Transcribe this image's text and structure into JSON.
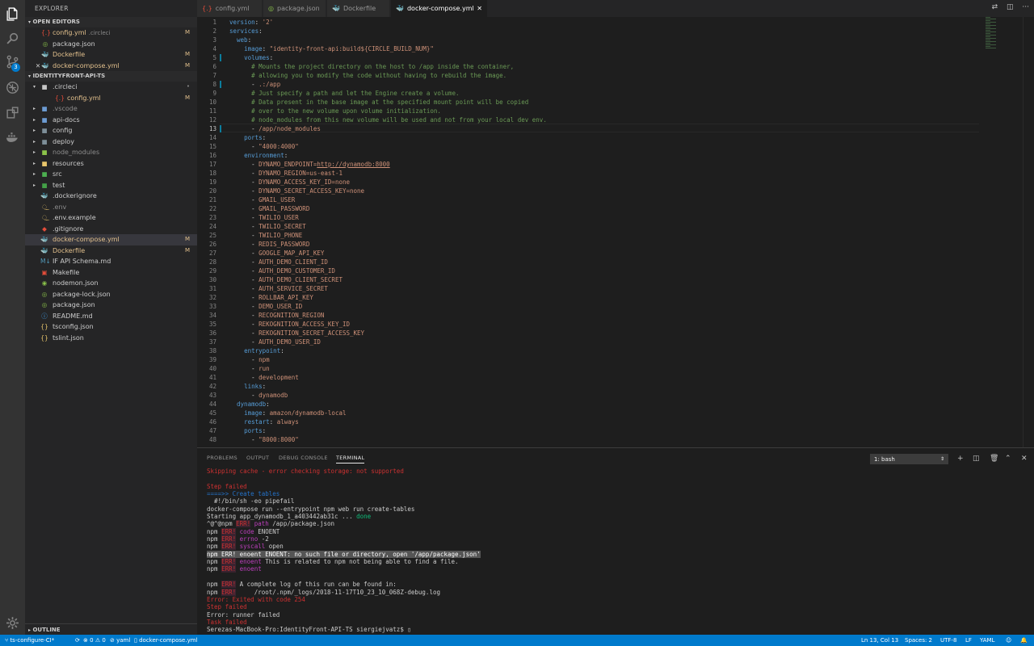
{
  "activity_bar": {
    "scm_badge": "3",
    "icons": [
      "explorer-icon",
      "search-icon",
      "source-control-icon",
      "debug-icon",
      "extensions-icon",
      "docker-icon",
      "gear-icon"
    ]
  },
  "sidebar": {
    "title": "EXPLORER",
    "open_editors": {
      "label": "OPEN EDITORS",
      "items": [
        {
          "icon": "{.}",
          "icon_color": "#e44d3a",
          "name": "config.yml",
          "desc": ".circleci",
          "status": "M"
        },
        {
          "icon": "◎",
          "icon_color": "#8bc34a",
          "name": "package.json",
          "desc": "",
          "status": ""
        },
        {
          "icon": "🐳",
          "icon_color": "#2496ed",
          "name": "Dockerfile",
          "desc": "",
          "status": "M"
        },
        {
          "icon": "🐳",
          "icon_color": "#2496ed",
          "name": "docker-compose.yml",
          "desc": "",
          "status": "M"
        }
      ]
    },
    "project": {
      "label": "IDENTITYFRONT-API-TS",
      "items": [
        {
          "name": ".circleci",
          "status": "•"
        },
        {
          "name": "config.yml",
          "status": "M"
        },
        {
          "name": ".vscode",
          "status": ""
        },
        {
          "name": "api-docs",
          "status": ""
        },
        {
          "name": "config",
          "status": ""
        },
        {
          "name": "deploy",
          "status": ""
        },
        {
          "name": "node_modules",
          "status": ""
        },
        {
          "name": "resources",
          "status": ""
        },
        {
          "name": "src",
          "status": ""
        },
        {
          "name": "test",
          "status": ""
        },
        {
          "name": ".dockerignore",
          "status": ""
        },
        {
          "name": ".env",
          "status": ""
        },
        {
          "name": ".env.example",
          "status": ""
        },
        {
          "name": ".gitignore",
          "status": ""
        },
        {
          "name": "docker-compose.yml",
          "status": "M"
        },
        {
          "name": "Dockerfile",
          "status": "M"
        },
        {
          "name": "IF API Schema.md",
          "status": ""
        },
        {
          "name": "Makefile",
          "status": ""
        },
        {
          "name": "nodemon.json",
          "status": ""
        },
        {
          "name": "package-lock.json",
          "status": ""
        },
        {
          "name": "package.json",
          "status": ""
        },
        {
          "name": "README.md",
          "status": ""
        },
        {
          "name": "tsconfig.json",
          "status": ""
        },
        {
          "name": "tslint.json",
          "status": ""
        }
      ]
    },
    "outline_label": "OUTLINE"
  },
  "tabs": [
    {
      "label": "config.yml",
      "icon": "{.}",
      "active": false
    },
    {
      "label": "package.json",
      "icon": "◎",
      "active": false
    },
    {
      "label": "Dockerfile",
      "icon": "🐳",
      "active": false
    },
    {
      "label": "docker-compose.yml",
      "icon": "🐳",
      "active": true
    }
  ],
  "editor": {
    "current_line": 13,
    "git_changed_lines": [
      5,
      8,
      13
    ]
  },
  "panel": {
    "tabs": [
      "PROBLEMS",
      "OUTPUT",
      "DEBUG CONSOLE",
      "TERMINAL"
    ],
    "active_tab": "TERMINAL",
    "terminal_select": "1: bash"
  },
  "status_bar": {
    "branch": "ts-configure-CI*",
    "errors": "0",
    "warnings": "0",
    "problems_icon": "0",
    "lang_server": "yaml",
    "file": "docker-compose.yml",
    "position": "Ln 13, Col 13",
    "spaces": "Spaces: 2",
    "encoding": "UTF-8",
    "eol": "LF",
    "language": "YAML"
  },
  "colors": {
    "accent": "#007acc",
    "modified": "#e2c08d",
    "error": "#cd3131"
  }
}
